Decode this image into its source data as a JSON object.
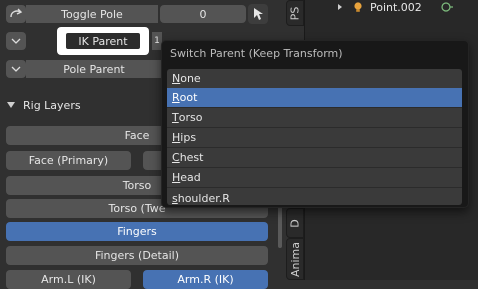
{
  "panel": {
    "toggle_pole_label": "Toggle Pole",
    "toggle_pole_value": "0",
    "ik_parent_label": "IK Parent",
    "ik_parent_value": "1",
    "pole_parent_label": "Pole Parent",
    "rig_layers_title": "Rig Layers",
    "layers": {
      "face": "Face",
      "face_primary": "Face (Primary)",
      "torso": "Torso",
      "torso_tweak": "Torso (Twe",
      "fingers": "Fingers",
      "fingers_detail": "Fingers (Detail)",
      "arm_l_ik": "Arm.L (IK)",
      "arm_r_ik": "Arm.R (IK)"
    }
  },
  "tabs": {
    "top": "PS",
    "middle": "D",
    "bottom": "Anima"
  },
  "outliner": {
    "item_label": "Point.002"
  },
  "popup": {
    "title": "Switch Parent (Keep Transform)",
    "options": [
      {
        "first": "N",
        "rest": "one"
      },
      {
        "first": "R",
        "rest": "oot"
      },
      {
        "first": "T",
        "rest": "orso"
      },
      {
        "first": "H",
        "rest": "ips"
      },
      {
        "first": "C",
        "rest": "hest"
      },
      {
        "first": "H",
        "rest": "ead"
      },
      {
        "first": "s",
        "rest": "houlder.R"
      }
    ],
    "active_option": "Root"
  },
  "colors": {
    "accent": "#4772b3",
    "button": "#545454",
    "panel_bg": "#303030",
    "popup_bg": "#181818"
  }
}
